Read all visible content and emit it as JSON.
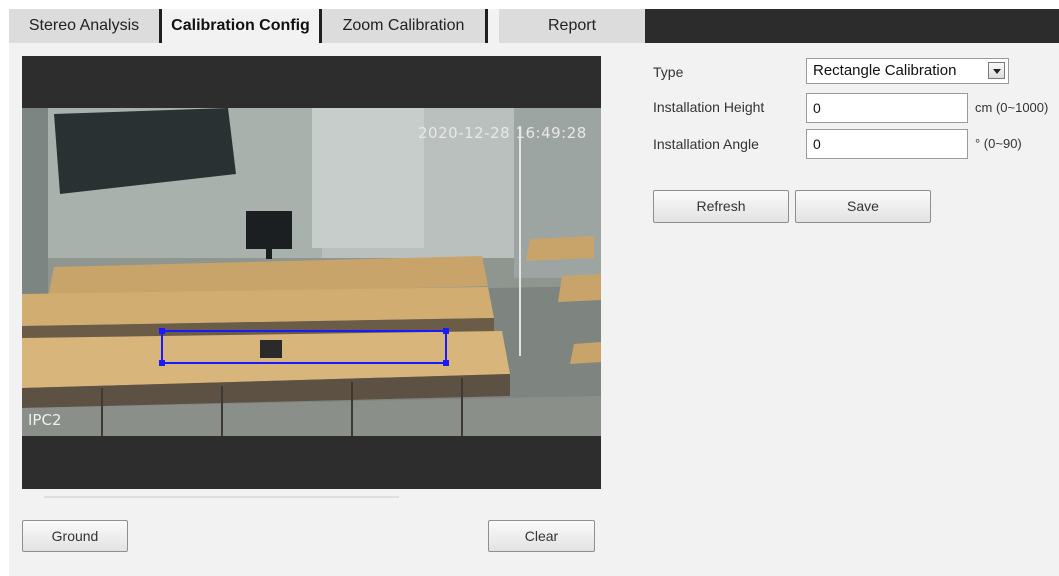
{
  "tabs": [
    {
      "label": "Stereo Analysis",
      "active": false
    },
    {
      "label": "Calibration Config",
      "active": true
    },
    {
      "label": "Zoom Calibration",
      "active": false
    },
    {
      "label": "Report",
      "active": false
    }
  ],
  "video": {
    "timestamp": "2020-12-28 16:49:28",
    "channel": "IPC2"
  },
  "form": {
    "type_label": "Type",
    "type_value": "Rectangle Calibration",
    "height_label": "Installation Height",
    "height_value": "0",
    "height_unit": "cm (0~1000)",
    "angle_label": "Installation Angle",
    "angle_value": "0",
    "angle_unit": "° (0~90)"
  },
  "buttons": {
    "refresh": "Refresh",
    "save": "Save",
    "ground": "Ground",
    "clear": "Clear"
  },
  "colors": {
    "calibration_box": "#1a1aff",
    "active_tab_bg": "#f2f2f2",
    "inactive_tab_bg": "#dcdcdc",
    "tabbar_fill": "#2c2c2c"
  }
}
